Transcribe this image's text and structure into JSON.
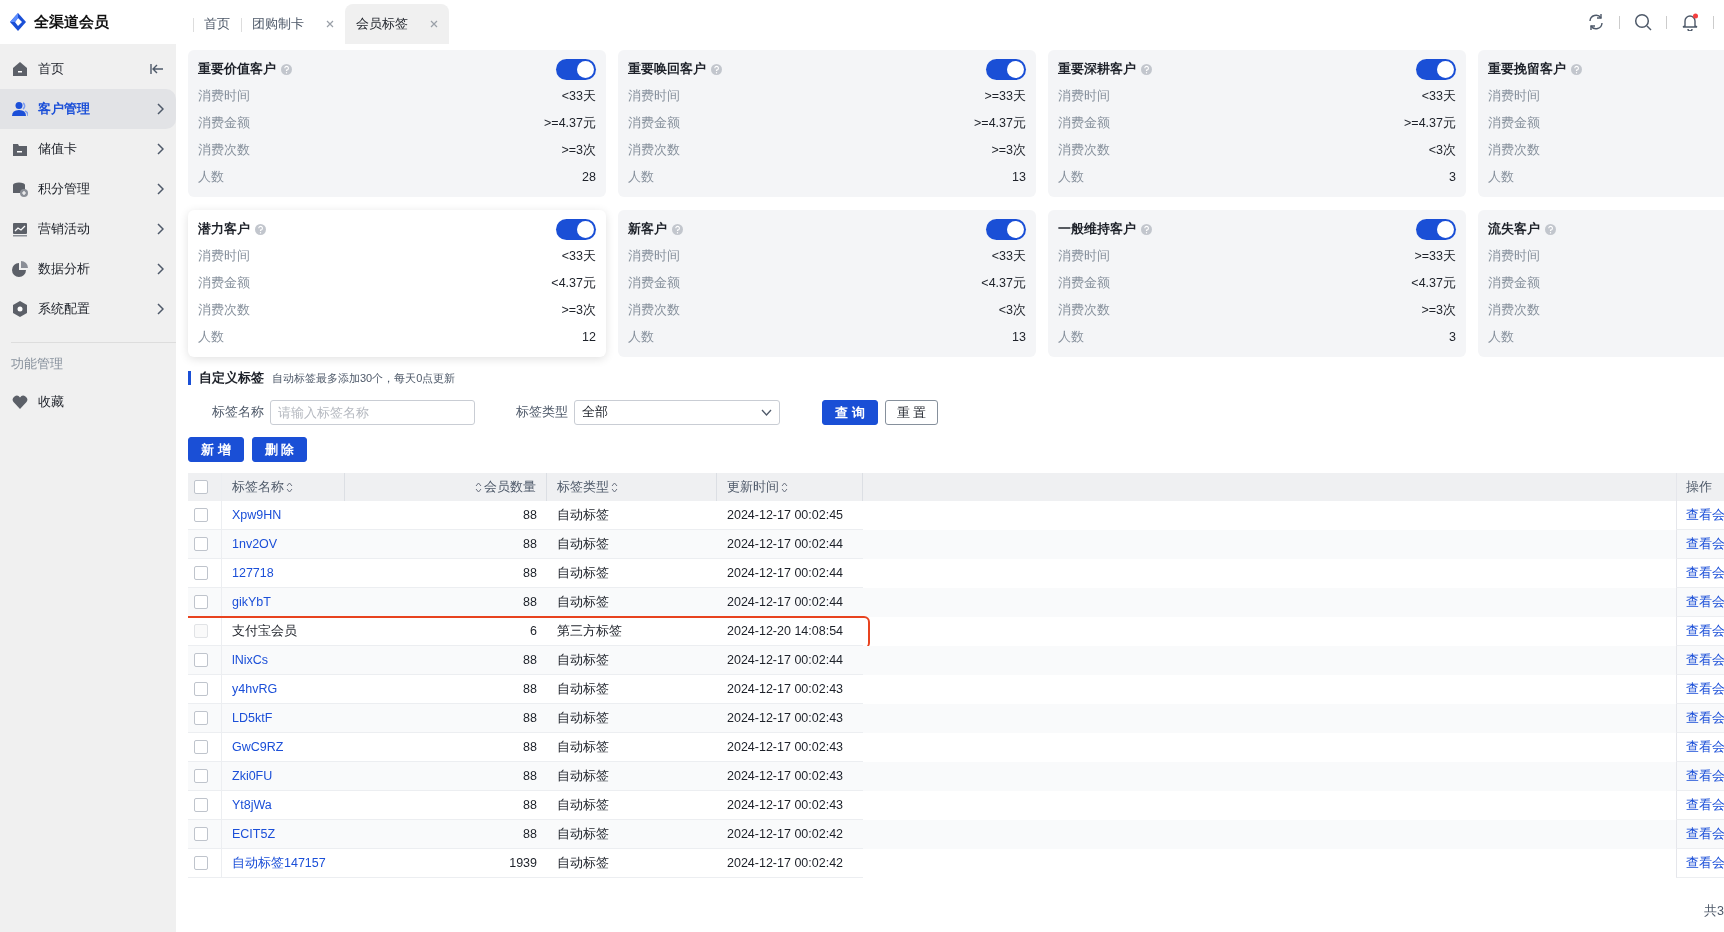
{
  "app": {
    "title": "全渠道会员"
  },
  "tabs": [
    {
      "label": "首页",
      "closable": false,
      "selected": false
    },
    {
      "label": "团购制卡",
      "closable": true,
      "selected": false
    },
    {
      "label": "会员标签",
      "closable": true,
      "selected": true
    }
  ],
  "header_actions": {
    "notification_dot": true
  },
  "sidebar": {
    "collapsible": true,
    "items": [
      {
        "label": "首页",
        "selected": false,
        "has_submenu": false
      },
      {
        "label": "客户管理",
        "selected": true,
        "has_submenu": true
      },
      {
        "label": "储值卡",
        "selected": false,
        "has_submenu": true
      },
      {
        "label": "积分管理",
        "selected": false,
        "has_submenu": true
      },
      {
        "label": "营销活动",
        "selected": false,
        "has_submenu": true
      },
      {
        "label": "数据分析",
        "selected": false,
        "has_submenu": true
      },
      {
        "label": "系统配置",
        "selected": false,
        "has_submenu": true
      }
    ],
    "section_title": "功能管理",
    "section_items": [
      {
        "label": "收藏"
      }
    ]
  },
  "segments": [
    {
      "title": "重要价值客户",
      "on": true,
      "hovered": false,
      "rows": [
        {
          "label": "消费时间",
          "value": "<33天"
        },
        {
          "label": "消费金额",
          "value": ">=4.37元"
        },
        {
          "label": "消费次数",
          "value": ">=3次"
        },
        {
          "label": "人数",
          "value": "28"
        }
      ]
    },
    {
      "title": "重要唤回客户",
      "on": true,
      "hovered": false,
      "rows": [
        {
          "label": "消费时间",
          "value": ">=33天"
        },
        {
          "label": "消费金额",
          "value": ">=4.37元"
        },
        {
          "label": "消费次数",
          "value": ">=3次"
        },
        {
          "label": "人数",
          "value": "13"
        }
      ]
    },
    {
      "title": "重要深耕客户",
      "on": true,
      "hovered": false,
      "rows": [
        {
          "label": "消费时间",
          "value": "<33天"
        },
        {
          "label": "消费金额",
          "value": ">=4.37元"
        },
        {
          "label": "消费次数",
          "value": "<3次"
        },
        {
          "label": "人数",
          "value": "3"
        }
      ]
    },
    {
      "title": "重要挽留客户",
      "hovered": false,
      "rows": [
        {
          "label": "消费时间"
        },
        {
          "label": "消费金额"
        },
        {
          "label": "消费次数"
        },
        {
          "label": "人数"
        }
      ]
    },
    {
      "title": "潜力客户",
      "on": true,
      "hovered": true,
      "rows": [
        {
          "label": "消费时间",
          "value": "<33天"
        },
        {
          "label": "消费金额",
          "value": "<4.37元"
        },
        {
          "label": "消费次数",
          "value": ">=3次"
        },
        {
          "label": "人数",
          "value": "12"
        }
      ]
    },
    {
      "title": "新客户",
      "on": true,
      "hovered": false,
      "rows": [
        {
          "label": "消费时间",
          "value": "<33天"
        },
        {
          "label": "消费金额",
          "value": "<4.37元"
        },
        {
          "label": "消费次数",
          "value": "<3次"
        },
        {
          "label": "人数",
          "value": "13"
        }
      ]
    },
    {
      "title": "一般维持客户",
      "on": true,
      "hovered": false,
      "rows": [
        {
          "label": "消费时间",
          "value": ">=33天"
        },
        {
          "label": "消费金额",
          "value": "<4.37元"
        },
        {
          "label": "消费次数",
          "value": ">=3次"
        },
        {
          "label": "人数",
          "value": "3"
        }
      ]
    },
    {
      "title": "流失客户",
      "hovered": false,
      "rows": [
        {
          "label": "消费时间"
        },
        {
          "label": "消费金额"
        },
        {
          "label": "消费次数"
        },
        {
          "label": "人数"
        }
      ]
    }
  ],
  "custom_tags": {
    "title": "自定义标签",
    "hint": "自动标签最多添加30个，每天0点更新"
  },
  "filters": [
    {
      "kind": "input",
      "label": "标签名称",
      "placeholder": "请输入标签名称"
    },
    {
      "kind": "select",
      "label": "标签类型",
      "value": "全部"
    }
  ],
  "filter_buttons": [
    {
      "label": "查 询",
      "kind": "primary"
    },
    {
      "label": "重 置",
      "kind": "outline"
    }
  ],
  "toolbar_buttons": [
    {
      "label": "新 增"
    },
    {
      "label": "删 除"
    }
  ],
  "table": {
    "select_all_checked": false,
    "columns": [
      {
        "label": "标签名称",
        "sortable": true
      },
      {
        "label": "会员数量",
        "sortable": true
      },
      {
        "label": "标签类型",
        "sortable": true
      },
      {
        "label": "更新时间",
        "sortable": true
      },
      {
        "label": "操作",
        "sortable": false
      }
    ],
    "rows": [
      {
        "name": "Xpw9HN",
        "count": "88",
        "type": "自动标签",
        "updated": "2024-12-17 00:02:45",
        "action": "查看会",
        "link": true,
        "disabled": false,
        "highlighted": false
      },
      {
        "name": "1nv2OV",
        "count": "88",
        "type": "自动标签",
        "updated": "2024-12-17 00:02:44",
        "action": "查看会",
        "link": true,
        "disabled": false,
        "highlighted": false
      },
      {
        "name": "127718",
        "count": "88",
        "type": "自动标签",
        "updated": "2024-12-17 00:02:44",
        "action": "查看会",
        "link": true,
        "disabled": false,
        "highlighted": false
      },
      {
        "name": "gikYbT",
        "count": "88",
        "type": "自动标签",
        "updated": "2024-12-17 00:02:44",
        "action": "查看会",
        "link": true,
        "disabled": false,
        "highlighted": false
      },
      {
        "name": "支付宝会员",
        "count": "6",
        "type": "第三方标签",
        "updated": "2024-12-20 14:08:54",
        "action": "查看会",
        "link": false,
        "disabled": true,
        "highlighted": true
      },
      {
        "name": "lNixCs",
        "count": "88",
        "type": "自动标签",
        "updated": "2024-12-17 00:02:44",
        "action": "查看会",
        "link": true,
        "disabled": false,
        "highlighted": false
      },
      {
        "name": "y4hvRG",
        "count": "88",
        "type": "自动标签",
        "updated": "2024-12-17 00:02:43",
        "action": "查看会",
        "link": true,
        "disabled": false,
        "highlighted": false
      },
      {
        "name": "LD5ktF",
        "count": "88",
        "type": "自动标签",
        "updated": "2024-12-17 00:02:43",
        "action": "查看会",
        "link": true,
        "disabled": false,
        "highlighted": false
      },
      {
        "name": "GwC9RZ",
        "count": "88",
        "type": "自动标签",
        "updated": "2024-12-17 00:02:43",
        "action": "查看会",
        "link": true,
        "disabled": false,
        "highlighted": false
      },
      {
        "name": "Zki0FU",
        "count": "88",
        "type": "自动标签",
        "updated": "2024-12-17 00:02:43",
        "action": "查看会",
        "link": true,
        "disabled": false,
        "highlighted": false
      },
      {
        "name": "Yt8jWa",
        "count": "88",
        "type": "自动标签",
        "updated": "2024-12-17 00:02:43",
        "action": "查看会",
        "link": true,
        "disabled": false,
        "highlighted": false
      },
      {
        "name": "ECIT5Z",
        "count": "88",
        "type": "自动标签",
        "updated": "2024-12-17 00:02:42",
        "action": "查看会",
        "link": true,
        "disabled": false,
        "highlighted": false
      },
      {
        "name": "自动标签147157",
        "count": "1939",
        "type": "自动标签",
        "updated": "2024-12-17 00:02:42",
        "action": "查看会",
        "link": true,
        "disabled": false,
        "highlighted": false
      }
    ]
  },
  "pagination": {
    "total": "共3"
  }
}
